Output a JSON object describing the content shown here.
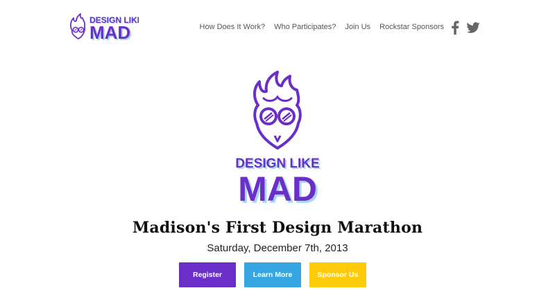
{
  "brand": {
    "logo_line1": "DESIGN LIKE",
    "logo_line2": "MAD",
    "colors": {
      "purple": "#6B2FC9",
      "light_blue": "#A9D7F2"
    }
  },
  "nav": {
    "items": [
      {
        "label": "How Does It Work?"
      },
      {
        "label": "Who Participates?"
      },
      {
        "label": "Join Us"
      },
      {
        "label": "Rockstar Sponsors"
      }
    ],
    "social": [
      {
        "icon": "facebook-icon"
      },
      {
        "icon": "twitter-icon"
      }
    ]
  },
  "hero": {
    "logo_line1": "DESIGN LIKE",
    "logo_line2": "MAD",
    "title": "Madison's First Design Marathon",
    "date": "Saturday, December 7th, 2013"
  },
  "buttons": [
    {
      "label": "Register",
      "color": "#6B2FC9"
    },
    {
      "label": "Learn More",
      "color": "#36A7E3"
    },
    {
      "label": "Sponsor Us",
      "color": "#FFCC0D"
    }
  ]
}
